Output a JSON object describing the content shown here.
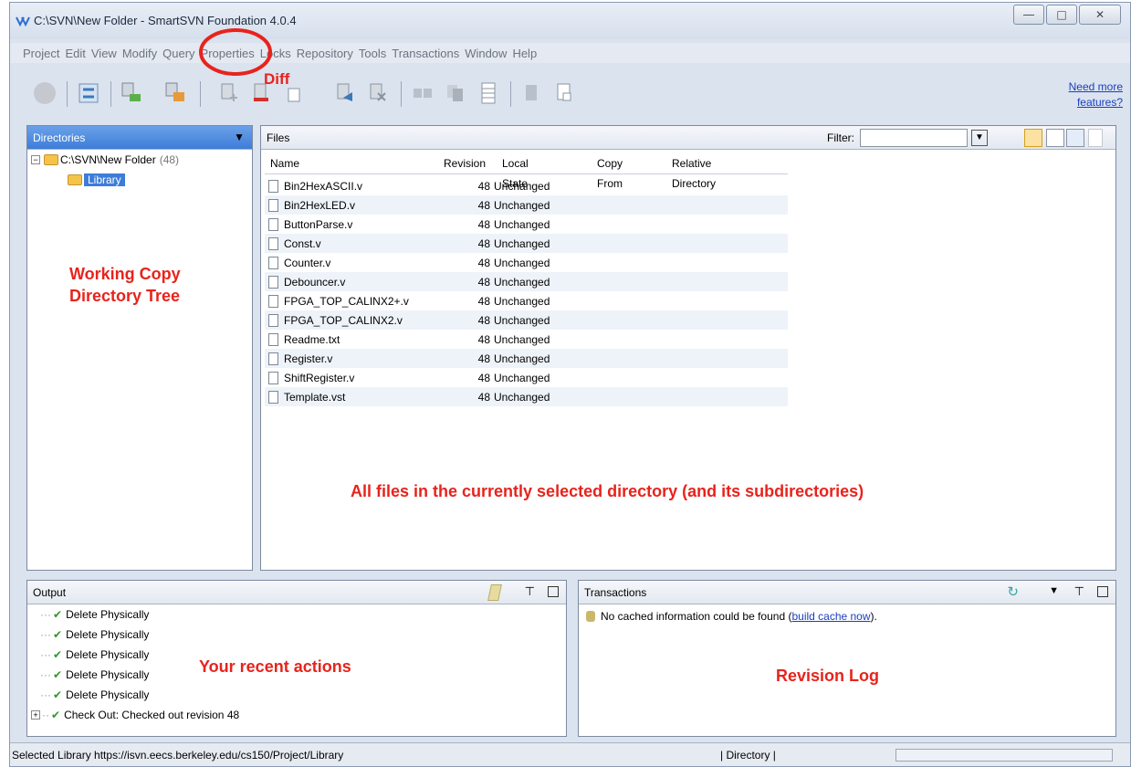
{
  "window": {
    "title": "C:\\SVN\\New Folder - SmartSVN Foundation 4.0.4",
    "controls": [
      "minimize-icon",
      "maximize-icon",
      "close-icon"
    ]
  },
  "menu": [
    "Project",
    "Edit",
    "View",
    "Modify",
    "Query",
    "Properties",
    "Locks",
    "Repository",
    "Tools",
    "Transactions",
    "Window",
    "Help"
  ],
  "toolbar": {
    "icons": [
      "stop-icon",
      "refresh-icon",
      "update-icon",
      "commit-icon",
      "add-icon",
      "remove-icon",
      "copy-icon",
      "move-icon",
      "ignore-icon",
      "compare-icon",
      "merge-icon",
      "log-icon",
      "properties-icon",
      "export-icon"
    ],
    "need_more_line1": "Need more",
    "need_more_line2": "features?"
  },
  "directories": {
    "header": "Directories",
    "root": {
      "label": "C:\\SVN\\New Folder",
      "count": "(48)"
    },
    "child": {
      "label": "Library"
    }
  },
  "files": {
    "header": "Files",
    "filter_label": "Filter:",
    "filter_value": "",
    "columns": [
      "Name",
      "Revision",
      "Local State",
      "Copy From",
      "Relative Directory"
    ],
    "rows": [
      {
        "name": "Bin2HexASCII.v",
        "revision": "48",
        "state": "Unchanged"
      },
      {
        "name": "Bin2HexLED.v",
        "revision": "48",
        "state": "Unchanged"
      },
      {
        "name": "ButtonParse.v",
        "revision": "48",
        "state": "Unchanged"
      },
      {
        "name": "Const.v",
        "revision": "48",
        "state": "Unchanged"
      },
      {
        "name": "Counter.v",
        "revision": "48",
        "state": "Unchanged"
      },
      {
        "name": "Debouncer.v",
        "revision": "48",
        "state": "Unchanged"
      },
      {
        "name": "FPGA_TOP_CALINX2+.v",
        "revision": "48",
        "state": "Unchanged"
      },
      {
        "name": "FPGA_TOP_CALINX2.v",
        "revision": "48",
        "state": "Unchanged"
      },
      {
        "name": "Readme.txt",
        "revision": "48",
        "state": "Unchanged"
      },
      {
        "name": "Register.v",
        "revision": "48",
        "state": "Unchanged"
      },
      {
        "name": "ShiftRegister.v",
        "revision": "48",
        "state": "Unchanged"
      },
      {
        "name": "Template.vst",
        "revision": "48",
        "state": "Unchanged"
      }
    ]
  },
  "output": {
    "header": "Output",
    "entries": [
      "Delete Physically",
      "Delete Physically",
      "Delete Physically",
      "Delete Physically",
      "Delete Physically",
      "Check Out: Checked out revision 48"
    ]
  },
  "transactions": {
    "header": "Transactions",
    "message": "No cached information could be found (",
    "link": "build cache now",
    "message_end": ")."
  },
  "status": {
    "text": "Selected Library https://isvn.eecs.berkeley.edu/cs150/Project/Library",
    "mode": "| Directory |"
  },
  "annotations": {
    "diff": "Diff",
    "working_copy_line1": "Working Copy",
    "working_copy_line2": "Directory Tree",
    "all_files": "All files in the currently selected directory (and its subdirectories)",
    "recent_actions": "Your recent actions",
    "revision_log": "Revision Log"
  },
  "colors": {
    "annotation": "#e8231c",
    "selection": "#3d7dd9",
    "link": "#1a3fc0"
  }
}
